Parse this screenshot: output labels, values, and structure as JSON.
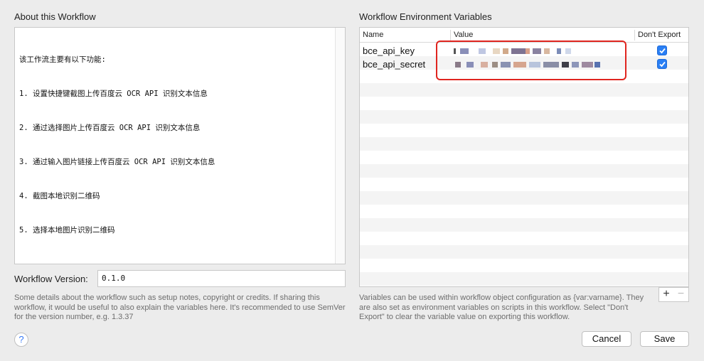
{
  "about": {
    "title": "About this Workflow",
    "lines": [
      "该工作流主要有以下功能:",
      "1. 设置快捷键截图上传百度云 OCR API 识别文本信息",
      "2. 通过选择图片上传百度云 OCR API 识别文本信息",
      "3. 通过输入图片链接上传百度云 OCR API 识别文本信息",
      "4. 截图本地识别二维码",
      "5. 选择本地图片识别二维码"
    ],
    "version_label": "Workflow Version:",
    "version_value": "0.1.0",
    "help": "Some details about the workflow such as setup notes, copyright or credits. If sharing this workflow, it would be useful to also explain the variables here. It's recommended to use SemVer for the version number, e.g. 1.3.37"
  },
  "variables": {
    "title": "Workflow Environment Variables",
    "columns": {
      "name": "Name",
      "value": "Value",
      "dont_export": "Don't Export"
    },
    "rows": [
      {
        "name": "bce_api_key",
        "dont_export": true
      },
      {
        "name": "bce_api_secret",
        "dont_export": true
      }
    ],
    "help": "Variables can be used within workflow object configuration as {var:varname}. They are also set as environment variables on scripts in this workflow. Select \"Don't Export\" to clear the variable value on exporting this workflow.",
    "add_label": "+",
    "remove_label": "−"
  },
  "footer": {
    "help_icon_label": "?",
    "cancel_label": "Cancel",
    "save_label": "Save"
  },
  "colors": {
    "accent": "#2a7ff4",
    "highlight": "#e0251f"
  }
}
